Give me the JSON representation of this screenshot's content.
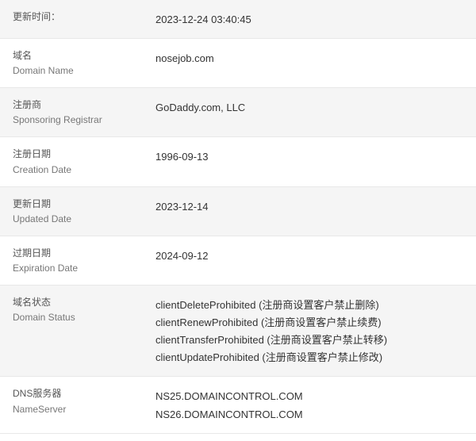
{
  "rows": [
    {
      "id": "update-time",
      "label_zh": "更新时间：",
      "label_en": "",
      "values": [
        "2023-12-24 03:40:45"
      ]
    },
    {
      "id": "domain-name",
      "label_zh": "域名",
      "label_en": "Domain Name",
      "values": [
        "nosejob.com"
      ]
    },
    {
      "id": "registrar",
      "label_zh": "注册商",
      "label_en": "Sponsoring Registrar",
      "values": [
        "GoDaddy.com, LLC"
      ]
    },
    {
      "id": "creation-date",
      "label_zh": "注册日期",
      "label_en": "Creation Date",
      "values": [
        "1996-09-13"
      ]
    },
    {
      "id": "updated-date",
      "label_zh": "更新日期",
      "label_en": "Updated Date",
      "values": [
        "2023-12-14"
      ]
    },
    {
      "id": "expiration-date",
      "label_zh": "过期日期",
      "label_en": "Expiration Date",
      "values": [
        "2024-09-12"
      ]
    },
    {
      "id": "domain-status",
      "label_zh": "域名状态",
      "label_en": "Domain Status",
      "values": [
        "clientDeleteProhibited (注册商设置客户禁止删除)",
        "clientRenewProhibited (注册商设置客户禁止续费)",
        "clientTransferProhibited (注册商设置客户禁止转移)",
        "clientUpdateProhibited (注册商设置客户禁止修改)"
      ]
    },
    {
      "id": "nameserver",
      "label_zh": "DNS服务器",
      "label_en": "NameServer",
      "values": [
        "NS25.DOMAINCONTROL.COM",
        "NS26.DOMAINCONTROL.COM"
      ]
    }
  ]
}
